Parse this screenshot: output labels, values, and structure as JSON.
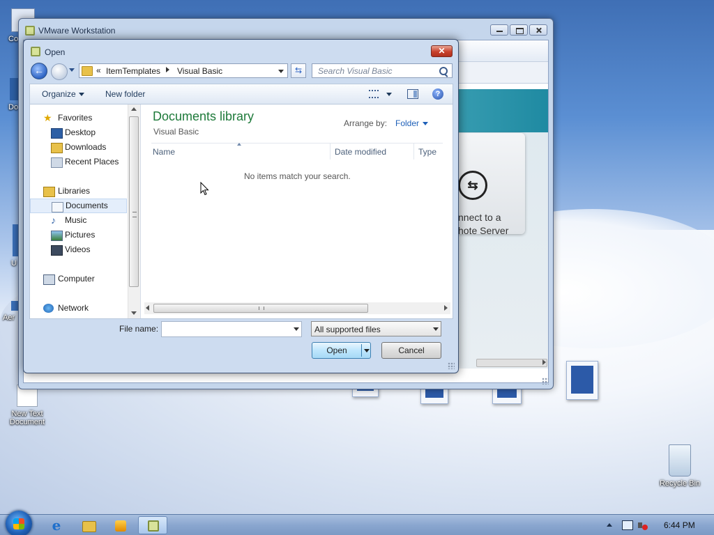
{
  "desktop": {
    "icons": [
      {
        "label": "New Text Document"
      },
      {
        "label": "Recycle Bin"
      }
    ],
    "partial_labels": [
      "Co",
      "Do",
      "U",
      "Aer"
    ]
  },
  "vmware": {
    "title": "VMware Workstation",
    "connect_text_line1": "nnect to a",
    "connect_text_line2": "hote Server"
  },
  "dialog": {
    "title": "Open",
    "close_label": "✕",
    "address": {
      "chevron": "«",
      "segment1": "ItemTemplates",
      "segment2": "Visual Basic"
    },
    "search_placeholder": "Search Visual Basic",
    "toolbar": {
      "organize": "Organize",
      "new_folder": "New folder",
      "help": "?"
    },
    "nav": {
      "favorites": "Favorites",
      "desktop": "Desktop",
      "downloads": "Downloads",
      "recent": "Recent Places",
      "libraries": "Libraries",
      "documents": "Documents",
      "music": "Music",
      "pictures": "Pictures",
      "videos": "Videos",
      "computer": "Computer",
      "network": "Network"
    },
    "library": {
      "title": "Documents library",
      "subtitle": "Visual Basic",
      "arrange_label": "Arrange by:",
      "arrange_value": "Folder"
    },
    "columns": [
      "Name",
      "Date modified",
      "Type"
    ],
    "empty_message": "No items match your search.",
    "file_name_label": "File name:",
    "file_name_value": "",
    "file_type": "All supported files",
    "open_button": "Open",
    "cancel_button": "Cancel"
  },
  "taskbar": {
    "clock": "6:44 PM"
  },
  "colors": {
    "library_title": "#1e7a3a",
    "link_blue": "#1e60b8",
    "close_red": "#c8412c"
  }
}
